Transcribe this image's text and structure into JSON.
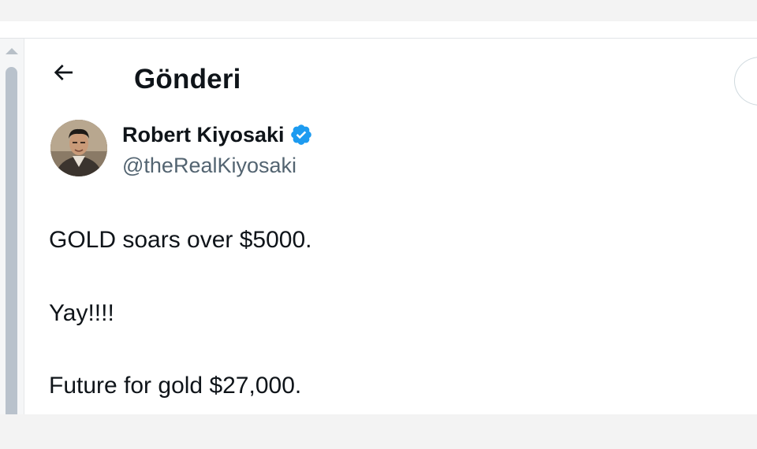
{
  "header": {
    "back_icon": "arrow-left-icon",
    "title": "Gönderi"
  },
  "author": {
    "name": "Robert Kiyosaki",
    "handle": "@theRealKiyosaki",
    "verified_icon": "verified-badge-icon",
    "verified_color": "#1d9bf0"
  },
  "tweet": {
    "lines": [
      "GOLD soars over $5000.",
      "Yay!!!!",
      "Future for gold $27,000."
    ]
  },
  "colors": {
    "text_primary": "#0f1419",
    "text_secondary": "#536471",
    "scrollbar_thumb": "#b9c2cc"
  }
}
